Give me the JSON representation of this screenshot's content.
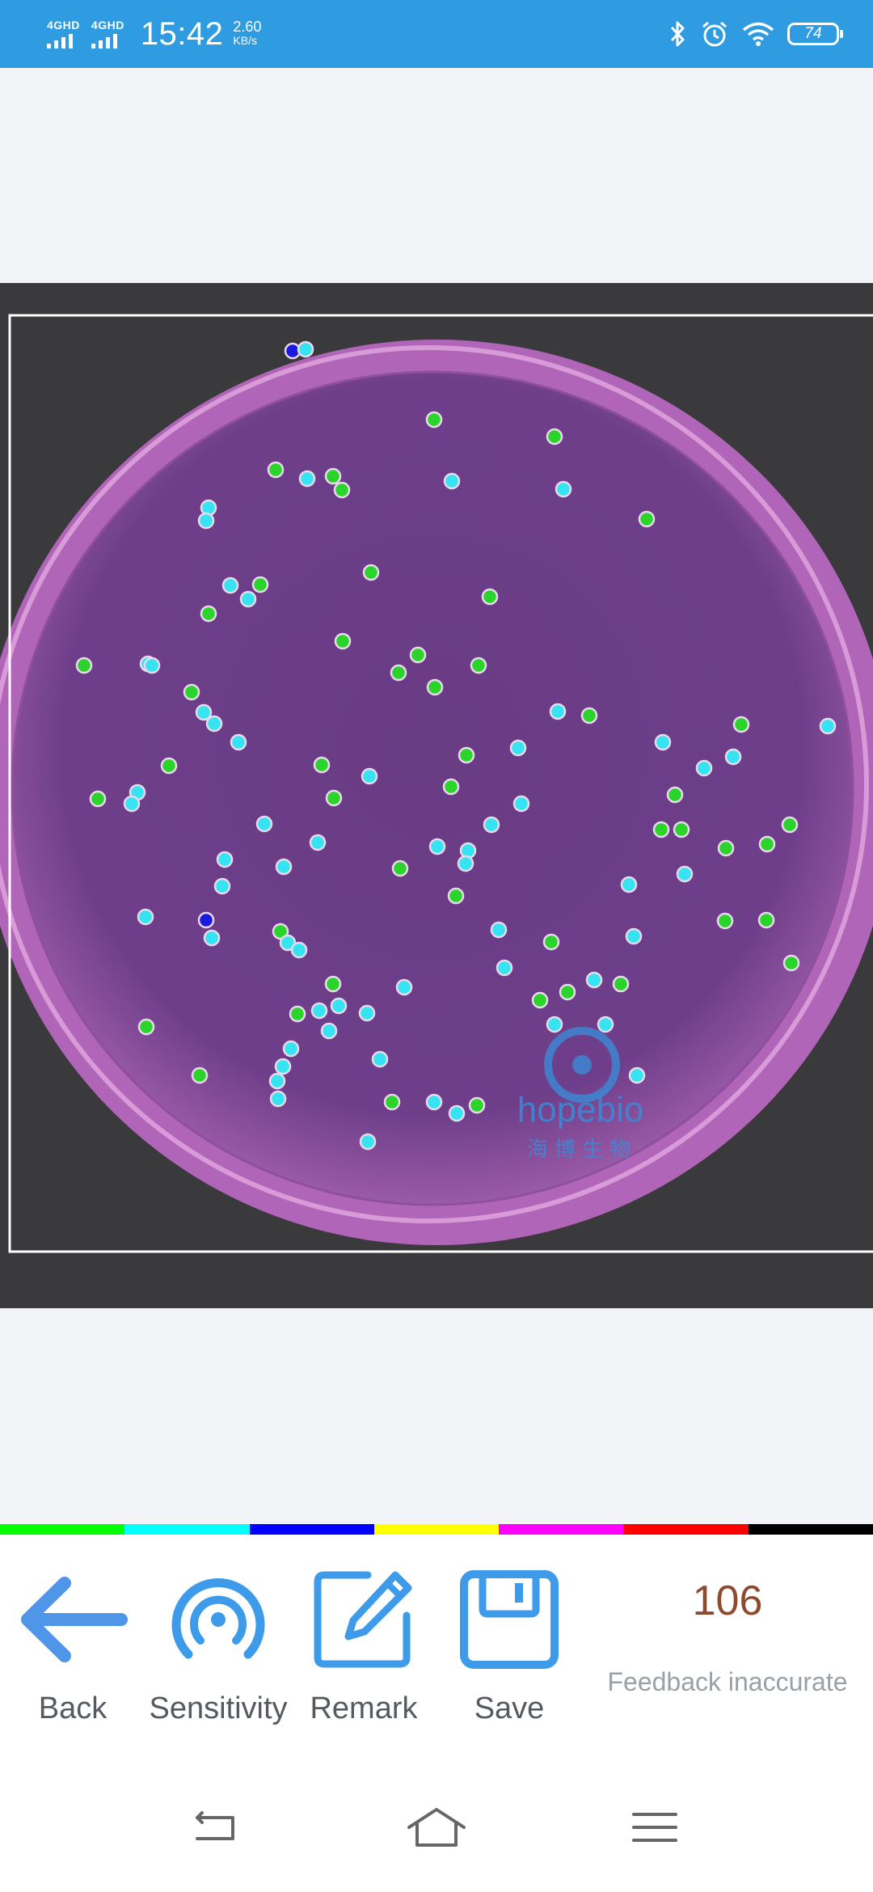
{
  "status_bar": {
    "sim1": "4GHD",
    "sim2": "4GHD",
    "time": "15:42",
    "speed_value": "2.60",
    "speed_unit": "KB/s",
    "battery": "74",
    "icons": [
      "bluetooth-icon",
      "alarm-icon",
      "wifi-icon",
      "battery-icon"
    ]
  },
  "plate": {
    "watermark_brand": "hopebio",
    "watermark_cn": "海博生物",
    "colony_colors": {
      "green": "#2bd42b",
      "cyan": "#36e3f0",
      "blue": "#1a1adf"
    },
    "plate_color": "#6a3c84"
  },
  "color_strip": [
    "#00ff00",
    "#00ffff",
    "#0000ff",
    "#ffff00",
    "#ff00ff",
    "#ff0000",
    "#000000"
  ],
  "toolbar": {
    "back_label": "Back",
    "sensitivity_label": "Sensitivity",
    "remark_label": "Remark",
    "save_label": "Save",
    "count": "106",
    "feedback_label": "Feedback inaccurate",
    "icon_color": "#3d9be9"
  },
  "nav_bar": {
    "icons": [
      "back-nav-icon",
      "home-nav-icon",
      "menu-nav-icon"
    ]
  }
}
